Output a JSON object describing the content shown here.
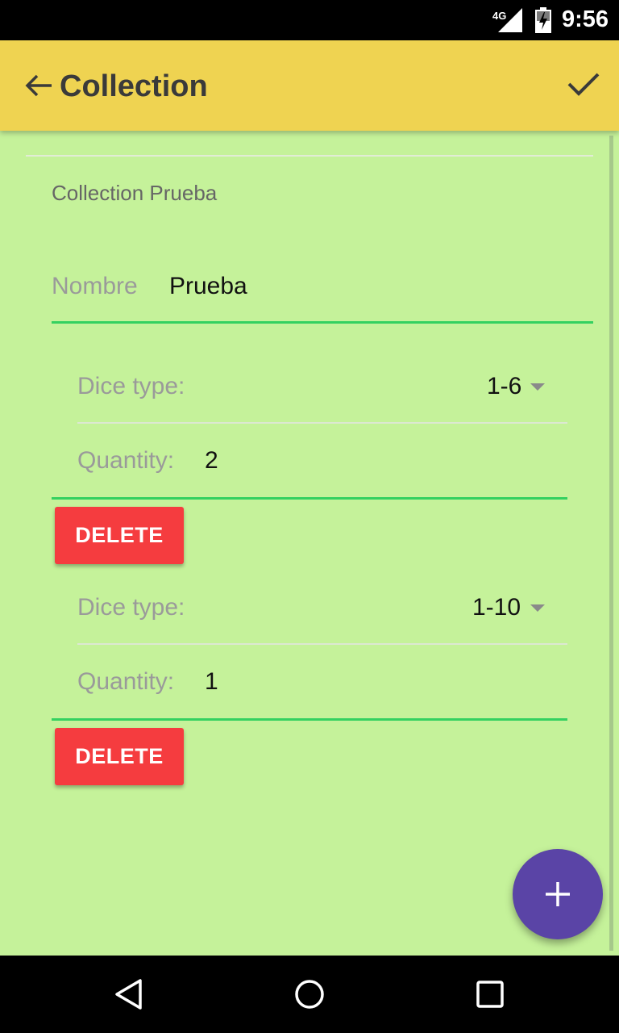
{
  "status_bar": {
    "network": "4G",
    "time": "9:56",
    "icons": [
      "signal-icon",
      "battery-charging-icon"
    ]
  },
  "app_bar": {
    "title": "Collection",
    "icons": [
      "back-arrow-icon",
      "check-icon"
    ]
  },
  "collection": {
    "section_label": "Collection Prueba",
    "name_label": "Nombre",
    "name_value": "Prueba"
  },
  "dice": [
    {
      "type_label": "Dice type:",
      "type_value": "1-6",
      "quantity_label": "Quantity:",
      "quantity_value": "2",
      "delete_label": "DELETE"
    },
    {
      "type_label": "Dice type:",
      "type_value": "1-10",
      "quantity_label": "Quantity:",
      "quantity_value": "1",
      "delete_label": "DELETE"
    }
  ],
  "fab": {
    "icon": "add-icon"
  },
  "nav_bar": {
    "icons": [
      "back-triangle-icon",
      "home-circle-icon",
      "recents-square-icon"
    ]
  },
  "colors": {
    "background": "#c5f29a",
    "app_bar": "#efd351",
    "accent_line": "#34d160",
    "delete_button": "#f53c3f",
    "fab": "#5a44a6"
  }
}
